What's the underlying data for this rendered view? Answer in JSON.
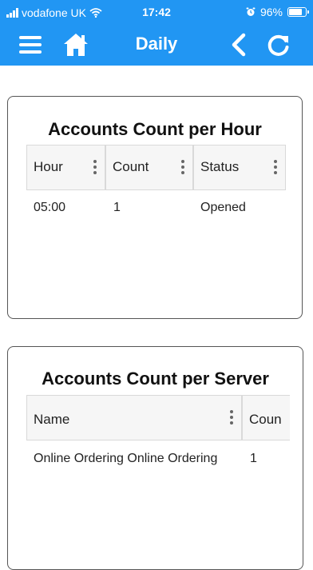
{
  "status_bar": {
    "carrier": "vodafone UK",
    "time": "17:42",
    "battery_percent": "96%",
    "battery_level": 0.96
  },
  "app_bar": {
    "title": "Daily",
    "icons": [
      "menu-icon",
      "home-icon",
      "back-icon",
      "refresh-icon"
    ]
  },
  "hour_card": {
    "title": "Accounts Count per Hour",
    "columns": [
      "Hour",
      "Count",
      "Status"
    ],
    "rows": [
      {
        "hour": "05:00",
        "count": "1",
        "status": "Opened"
      }
    ]
  },
  "server_card": {
    "title": "Accounts Count per Server",
    "columns": [
      "Name",
      "Coun"
    ],
    "rows": [
      {
        "name": "Online Ordering Online Ordering",
        "count": "1"
      }
    ]
  },
  "colors": {
    "header_blue": "#2196f3",
    "card_border": "#555555",
    "grid_header_bg": "#f6f6f6"
  }
}
